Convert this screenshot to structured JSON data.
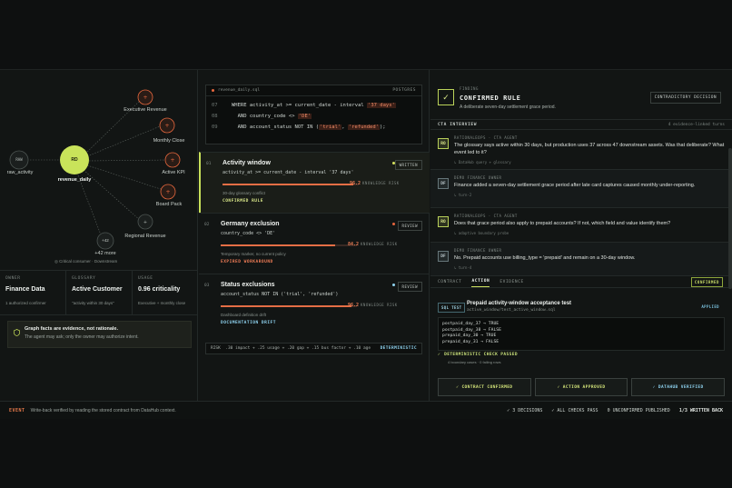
{
  "graph": {
    "nodes": [
      {
        "id": "raw",
        "badge": "RAW",
        "label": "raw_activity"
      },
      {
        "id": "rd",
        "badge": "RD",
        "label": "revenue_daily"
      },
      {
        "id": "exec",
        "label": "Executive Revenue"
      },
      {
        "id": "monthly",
        "label": "Monthly Close"
      },
      {
        "id": "kpi",
        "label": "Active KPI"
      },
      {
        "id": "board",
        "label": "Board Pack"
      },
      {
        "id": "regional",
        "label": "Regional Revenue"
      },
      {
        "id": "more",
        "badge": "+42",
        "label": "+42 more"
      }
    ],
    "legend": "◎ Critical consumer · Downstream"
  },
  "stats": [
    {
      "key": "OWNER",
      "value": "Finance Data",
      "sub": "1 authorized confirmer"
    },
    {
      "key": "GLOSSARY",
      "value": "Active Customer",
      "sub": "\"activity within 30 days\""
    },
    {
      "key": "USAGE",
      "value": "0.96 criticality",
      "sub": "Executive + monthly close"
    }
  ],
  "note": {
    "title": "Graph facts are evidence, not rationale.",
    "body": "The agent may ask; only the owner may authorize intent."
  },
  "code": {
    "file": "revenue_daily.sql",
    "engine": "POSTGRES",
    "lines": [
      {
        "n": "07",
        "pre": "WHERE activity_at >= current_date - interval ",
        "hl": "'37 days'",
        "post": ""
      },
      {
        "n": "08",
        "pre": "  AND country_code <> ",
        "hl": "'DE'",
        "post": ""
      },
      {
        "n": "09",
        "pre": "  AND account_status NOT IN (",
        "hl": "'trial'",
        "mid": ", ",
        "hl2": "'refunded'",
        "post": ");"
      }
    ]
  },
  "rules": [
    {
      "num": "01",
      "title": "Activity window",
      "expr": "activity_at >= current_date - interval '37 days'",
      "score": "96.2",
      "risk": "KNOWLEDGE RISK",
      "fill": 0.962,
      "sub": "30-day glossary conflict",
      "tag": "CONFIRMED RULE",
      "tag_color": "#dbe98a",
      "badge": "WRITTEN",
      "dot": "#d6e35f"
    },
    {
      "num": "02",
      "title": "Germany exclusion",
      "expr": "country_code <> 'DE'",
      "score": "84.2",
      "risk": "KNOWLEDGE RISK",
      "fill": 0.842,
      "sub": "Temporary marker, no current policy",
      "tag": "EXPIRED WORKAROUND",
      "tag_color": "#ef7c56",
      "badge": "REVIEW",
      "dot": "#e8653d"
    },
    {
      "num": "03",
      "title": "Status exclusions",
      "expr": "account_status NOT IN ('trial', 'refunded')",
      "score": "96.2",
      "risk": "KNOWLEDGE RISK",
      "fill": 0.962,
      "sub": "Dashboard definition drift",
      "tag": "DOCUMENTATION DRIFT",
      "tag_color": "#8fd3f0",
      "badge": "REVIEW",
      "dot": "#8fd3f0"
    }
  ],
  "weights": {
    "formula": "RISK  .30 impact + .25 usage + .20 gap + .15 bus factor + .10 age",
    "mode": "DETERMINISTIC"
  },
  "finding": {
    "label": "FINDING",
    "title": "CONFIRMED RULE",
    "desc": "A deliberate seven-day settlement grace period.",
    "button": "CONTRADICTORY DECISION"
  },
  "interview": {
    "heading": "CTA INTERVIEW",
    "count": "4 evidence-linked turns",
    "turns": [
      {
        "av": "RO",
        "who": "RATIONALEOPS · CTA AGENT",
        "text": "The glossary says active within 30 days, but production uses 37 across 47 downstream assets. Was that deliberate? What event led to it?",
        "meta": "↳ DataHub query + glossary",
        "type": "agent"
      },
      {
        "av": "DF",
        "who": "DEMO FINANCE OWNER",
        "text": "Finance added a seven-day settlement grace period after late card captures caused monthly under-reporting.",
        "meta": "↳ turn-2",
        "type": "user"
      },
      {
        "av": "RO",
        "who": "RATIONALEOPS · CTA AGENT",
        "text": "Does that grace period also apply to prepaid accounts? If not, which field and value identify them?",
        "meta": "↳ adaptive boundary probe",
        "type": "agent"
      },
      {
        "av": "DF",
        "who": "DEMO FINANCE OWNER",
        "text": "No. Prepaid accounts use billing_type = 'prepaid' and remain on a 30-day window.",
        "meta": "↳ turn-4",
        "type": "user"
      }
    ]
  },
  "tabs": [
    "CONTRACT",
    "ACTION",
    "EVIDENCE"
  ],
  "tabs_status": "CONFIRMED",
  "test": {
    "badge": "SQL TEST",
    "title": "Prepaid activity-window acceptance test",
    "path": "active_window/test_active_window.sql",
    "status": "APPLIED",
    "output": [
      "postpaid_day_37 → TRUE",
      "postpaid_day_38 → FALSE",
      "prepaid_day_30 → TRUE",
      "prepaid_day_31 → FALSE"
    ]
  },
  "check": {
    "title": "DETERMINISTIC CHECK PASSED",
    "sub": "4 boundary cases · 0 failing rows"
  },
  "actions": [
    {
      "label": "✓ CONTRACT CONFIRMED",
      "color": "#d4e57a"
    },
    {
      "label": "✓ ACTION APPROVED",
      "color": "#d4e57a"
    },
    {
      "label": "✓ DATAHUB VERIFIED",
      "color": "#8fd3f0"
    }
  ],
  "footer": {
    "event": "EVENT",
    "text": "Write-back verified by reading the stored contract from DataHub context.",
    "stats": [
      "✓ 3 DECISIONS",
      "✓ ALL CHECKS PASS",
      "0 UNCONFIRMED PUBLISHED",
      "1/3 WRITTEN BACK"
    ]
  }
}
